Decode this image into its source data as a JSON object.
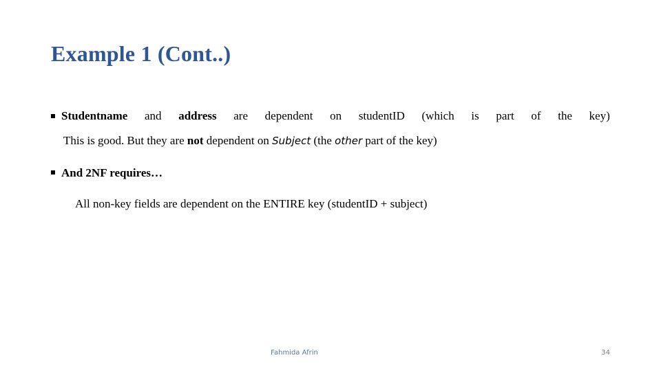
{
  "slide": {
    "title": "Example 1 (Cont..)",
    "bullets": [
      {
        "words": [
          "Studentname",
          "and",
          "address",
          "are",
          "dependent",
          "on",
          "studentID",
          "(which",
          "is",
          "part",
          "of",
          "the",
          "key)"
        ],
        "continuation": {
          "part1": "This is good. But they are ",
          "bold": "not",
          "part2": " dependent on ",
          "italic1": "Subject",
          "part3": " (the ",
          "italic2": "other",
          "part4": " part of the key)"
        }
      },
      {
        "text": "And 2NF requires…",
        "sub_text": "All non-key fields are dependent on the ENTIRE key (studentID + subject)"
      }
    ]
  },
  "footer": {
    "author": "Fahmida Afrin",
    "page_number": "34"
  }
}
